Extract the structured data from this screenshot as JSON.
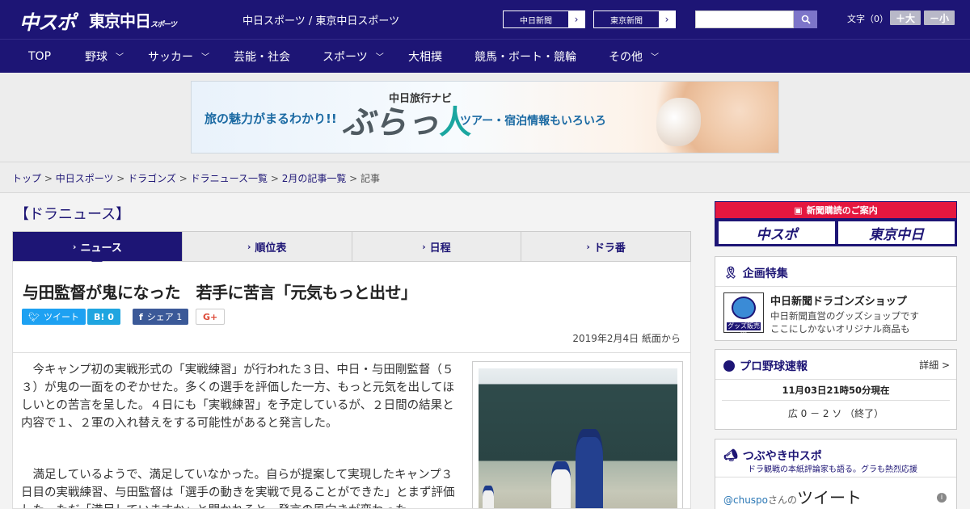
{
  "header": {
    "logo_chuspo": "中スポ",
    "logo_tokyo": "東京中日",
    "logo_tokyo_sub": "スポーツ",
    "site_name": "中日スポーツ / 東京中日スポーツ",
    "links": [
      "中日新聞",
      "東京新聞"
    ],
    "search_placeholder": "",
    "font_label": "文字（0）",
    "font_plus": "＋大",
    "font_minus": "－小"
  },
  "nav": {
    "items": [
      "TOP",
      "野球",
      "サッカー",
      "芸能・社会",
      "スポーツ",
      "大相撲",
      "競馬・ボート・競輪",
      "その他"
    ]
  },
  "ad": {
    "left": "旅の魅力がまるわかり!!",
    "small": "中日旅行ナビ",
    "big_a": "ぶらっ",
    "big_b": "人",
    "right": "ツアー・宿泊情報もいろいろ"
  },
  "breadcrumb": {
    "items": [
      "トップ",
      "中日スポーツ",
      "ドラゴンズ",
      "ドラニュース一覧",
      "2月の記事一覧"
    ],
    "current": "記事"
  },
  "section_title": "【ドラニュース】",
  "tabs": [
    "ニュース",
    "順位表",
    "日程",
    "ドラ番"
  ],
  "article": {
    "headline": "与田監督が鬼になった　若手に苦言「元気もっと出せ」",
    "share": {
      "tweet": "ツイート",
      "hatena": "B! 0",
      "facebook": "シェア 1",
      "gplus": "G+"
    },
    "date": "2019年2月4日 紙面から",
    "para1": "今キャンプ初の実戦形式の「実戦練習」が行われた３日、中日・与田剛監督（５３）が鬼の一面をのぞかせた。多くの選手を評価した一方、もっと元気を出してほしいとの苦言を呈した。４日にも「実戦練習」を予定しているが、２日間の結果と内容で１、２軍の入れ替えをする可能性があると発言した。",
    "para2": "満足しているようで、満足していなかった。自らが提案して実現したキャンプ３日目の実戦練習、与田監督は「選手の動きを実戦で見ることができた」とまず評価した。ただ「満足していますか」と聞かれると、発言の風向きが変わった。"
  },
  "sidebar": {
    "subs_title": "新聞購読のご案内",
    "subs_chuspo": "中スポ",
    "subs_tokyo": "東京中日",
    "special_title": "企画特集",
    "shop_title": "中日新聞ドラゴンズショップ",
    "shop_desc1": "中日新聞直営のグッズショップです",
    "shop_desc2": "ここにしかないオリジナル商品も",
    "shop_badge": "グッズ販売中",
    "baseball_title": "プロ野球速報",
    "baseball_detail": "詳細 >",
    "baseball_time": "11月03日21時50分現在",
    "baseball_score": "広 0 － 2 ソ （終了）",
    "tsubuyaki_title": "つぶやき中スポ",
    "tsubuyaki_sub": "ドラ観戦の本紙評論家も語る。グラも熱烈応援",
    "tweet_user": "@chuspo",
    "tweet_suffix": "さんの",
    "tweet_label": "ツイート"
  }
}
